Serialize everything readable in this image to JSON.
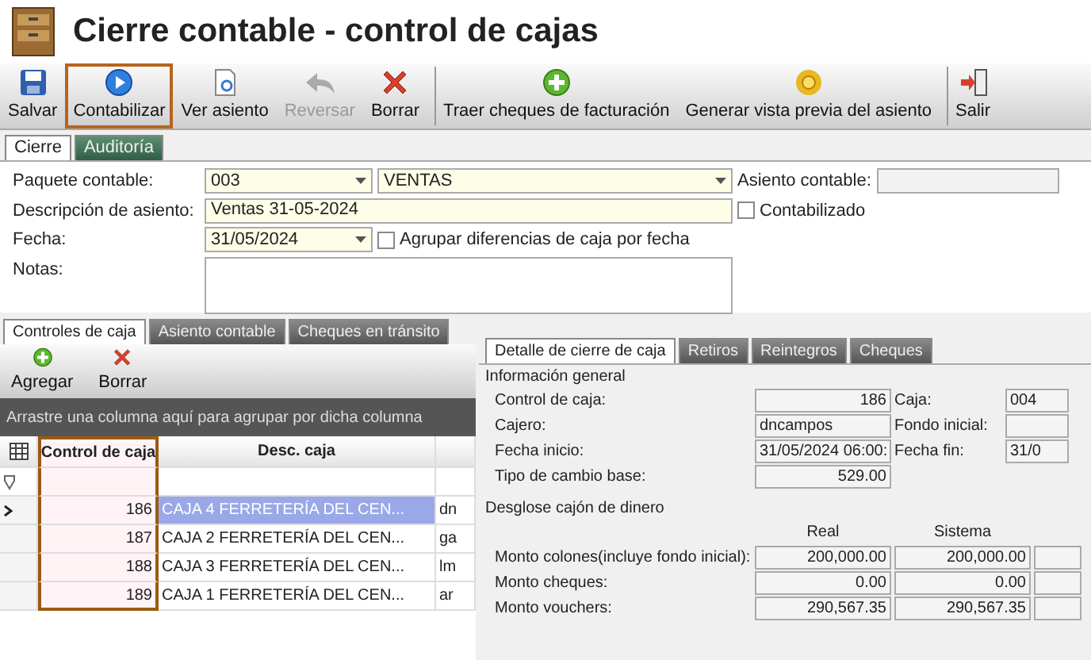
{
  "window": {
    "title": "Cierre contable - control de cajas"
  },
  "toolbar": [
    {
      "kind": "save",
      "label": "Salvar",
      "disabled": false,
      "highlighted": false,
      "separated": false
    },
    {
      "kind": "post",
      "label": "Contabilizar",
      "disabled": false,
      "highlighted": true,
      "separated": false
    },
    {
      "kind": "view",
      "label": "Ver asiento",
      "disabled": false,
      "highlighted": false,
      "separated": false
    },
    {
      "kind": "undo",
      "label": "Reversar",
      "disabled": true,
      "highlighted": false,
      "separated": false
    },
    {
      "kind": "delete",
      "label": "Borrar",
      "disabled": false,
      "highlighted": false,
      "separated": false
    },
    {
      "kind": "add",
      "label": "Traer cheques de facturación",
      "disabled": false,
      "highlighted": false,
      "separated": true
    },
    {
      "kind": "preview",
      "label": "Generar vista previa del asiento",
      "disabled": false,
      "highlighted": false,
      "separated": false
    },
    {
      "kind": "exit",
      "label": "Salir",
      "disabled": false,
      "highlighted": false,
      "separated": true
    }
  ],
  "top_tabs": [
    {
      "label": "Cierre",
      "selected": true
    },
    {
      "label": "Auditoría",
      "selected": false
    }
  ],
  "form": {
    "package_label": "Paquete contable:",
    "package_code": "003",
    "package_name": "VENTAS",
    "description_label": "Descripción de asiento:",
    "description": "Ventas 31-05-2024",
    "date_label": "Fecha:",
    "date": "31/05/2024",
    "group_checkbox": {
      "label": "Agrupar diferencias de caja por fecha",
      "checked": false
    },
    "notes_label": "Notas:",
    "entry_label": "Asiento contable:",
    "posted_checkbox": {
      "label": "Contabilizado",
      "checked": false
    }
  },
  "left_tabs": [
    {
      "label": "Controles de caja",
      "selected": true
    },
    {
      "label": "Asiento contable",
      "selected": false
    },
    {
      "label": "Cheques en tránsito",
      "selected": false
    }
  ],
  "left_toolbar": [
    {
      "kind": "add",
      "label": "Agregar"
    },
    {
      "kind": "delete",
      "label": "Borrar"
    }
  ],
  "group_hint": "Arrastre una columna aquí para agrupar por dicha columna",
  "grid": {
    "columns": [
      {
        "label": "Control de caja",
        "highlighted": true
      },
      {
        "label": "Desc. caja",
        "highlighted": false
      }
    ],
    "rows": [
      {
        "selected": true,
        "cells": [
          "186",
          "CAJA 4 FERRETERÍA DEL CEN...",
          "dn"
        ]
      },
      {
        "selected": false,
        "cells": [
          "187",
          "CAJA 2 FERRETERÍA DEL CEN...",
          "ga"
        ]
      },
      {
        "selected": false,
        "cells": [
          "188",
          "CAJA 3 FERRETERÍA DEL CEN...",
          "lm"
        ]
      },
      {
        "selected": false,
        "cells": [
          "189",
          "CAJA 1 FERRETERÍA DEL CEN...",
          "ar"
        ]
      }
    ]
  },
  "right_tabs": [
    {
      "label": "Detalle de cierre de caja",
      "selected": true
    },
    {
      "label": "Retiros",
      "selected": false
    },
    {
      "label": "Reintegros",
      "selected": false
    },
    {
      "label": "Cheques",
      "selected": false
    }
  ],
  "general": {
    "title": "Información general",
    "rows": [
      {
        "label": "Control de caja:",
        "value": "186",
        "label_2": "Caja:",
        "value_2": "004"
      },
      {
        "label": "Cajero:",
        "value": "dncampos",
        "label_2": "Fondo inicial:"
      },
      {
        "label": "Fecha inicio:",
        "value": "31/05/2024 06:00:",
        "label_2": "Fecha fin:",
        "value_2": "31/0"
      },
      {
        "label": "Tipo de cambio base:",
        "value": "529.00"
      }
    ]
  },
  "cash": {
    "title": "Desglose cajón de dinero",
    "columns": [
      "Real",
      "Sistema"
    ],
    "rows": [
      {
        "label": "Monto colones(incluye fondo inicial):",
        "real": "200,000.00",
        "system": "200,000.00"
      },
      {
        "label": "Monto cheques:",
        "real": "0.00",
        "system": "0.00"
      },
      {
        "label": "Monto vouchers:",
        "real": "290,567.35",
        "system": "290,567.35"
      }
    ]
  }
}
